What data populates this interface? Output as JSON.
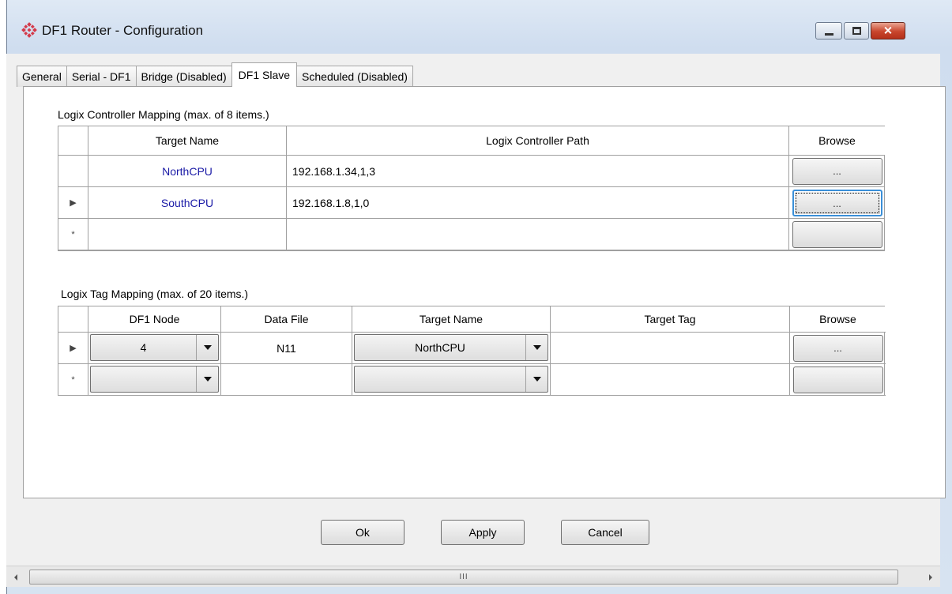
{
  "window": {
    "title": "DF1 Router - Configuration"
  },
  "tabs": [
    "General",
    "Serial - DF1",
    "Bridge (Disabled)",
    "DF1 Slave",
    "Scheduled (Disabled)"
  ],
  "active_tab": "DF1 Slave",
  "controller_mapping": {
    "label": "Logix Controller Mapping (max. of 8 items.)",
    "headers": {
      "target_name": "Target Name",
      "path": "Logix Controller Path",
      "browse": "Browse"
    },
    "rows": [
      {
        "target_name": "NorthCPU",
        "path": "192.168.1.34,1,3",
        "browse": "...",
        "marker": ""
      },
      {
        "target_name": "SouthCPU",
        "path": "192.168.1.8,1,0",
        "browse": "...",
        "marker": "▶"
      },
      {
        "target_name": "",
        "path": "",
        "browse": "",
        "marker": "*"
      }
    ]
  },
  "tag_mapping": {
    "label": "Logix Tag Mapping (max. of 20 items.)",
    "headers": {
      "df1_node": "DF1 Node",
      "data_file": "Data File",
      "target_name": "Target Name",
      "target_tag": "Target Tag",
      "browse": "Browse"
    },
    "rows": [
      {
        "df1_node": "4",
        "data_file": "N11",
        "target_name": "NorthCPU",
        "target_tag": "",
        "browse": "...",
        "marker": "▶"
      },
      {
        "df1_node": "",
        "data_file": "",
        "target_name": "",
        "target_tag": "",
        "browse": "",
        "marker": "*"
      }
    ]
  },
  "buttons": {
    "ok": "Ok",
    "apply": "Apply",
    "cancel": "Cancel"
  },
  "scrollbar": {
    "thumb_grip": "III"
  }
}
